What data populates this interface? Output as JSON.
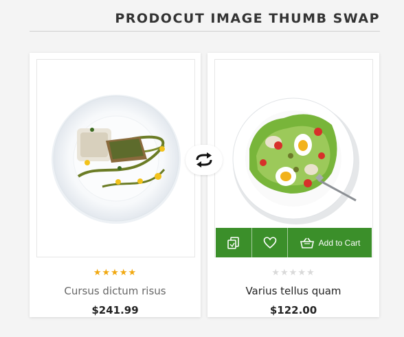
{
  "section": {
    "title": "PRODOCUT IMAGE THUMB SWAP"
  },
  "products": [
    {
      "name": "Cursus dictum risus",
      "price": "$241.99",
      "rating": 5,
      "rating_max": 5
    },
    {
      "name": "Varius tellus quam",
      "price": "$122.00",
      "rating": 0,
      "rating_max": 5
    }
  ],
  "actions": {
    "compare_icon": "compare-icon",
    "wishlist_icon": "heart-icon",
    "cart_icon": "basket-icon",
    "add_to_cart_label": "Add to Cart"
  },
  "swap": {
    "icon": "swap-arrows-icon"
  },
  "colors": {
    "accent_green": "#3b8f2a",
    "star_filled": "#f1a80f",
    "star_empty": "#d9d9d9",
    "title_text": "#333333"
  }
}
